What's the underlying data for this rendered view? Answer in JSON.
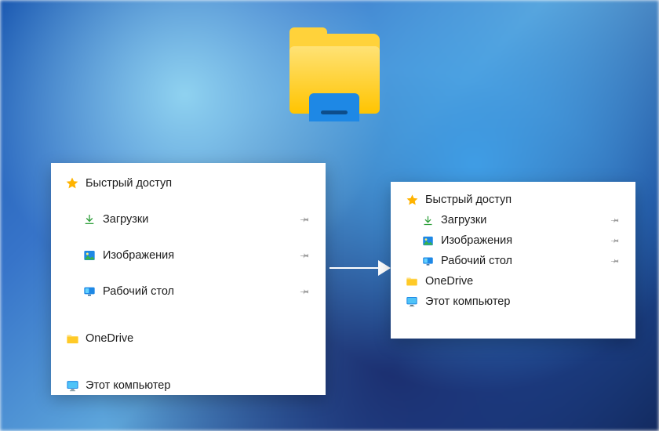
{
  "colors": {
    "accent_yellow": "#ffc400",
    "accent_blue": "#1e88e5",
    "pin_gray": "#a0a0a0"
  },
  "left": {
    "quick_access": "Быстрый доступ",
    "items": [
      {
        "label": "Загрузки",
        "icon": "download-icon",
        "pinned": true
      },
      {
        "label": "Изображения",
        "icon": "pictures-icon",
        "pinned": true
      },
      {
        "label": "Рабочий стол",
        "icon": "desktop-icon",
        "pinned": true
      }
    ],
    "onedrive": "OneDrive",
    "this_pc": "Этот компьютер"
  },
  "right": {
    "quick_access": "Быстрый доступ",
    "items": [
      {
        "label": "Загрузки",
        "icon": "download-icon",
        "pinned": true
      },
      {
        "label": "Изображения",
        "icon": "pictures-icon",
        "pinned": true
      },
      {
        "label": "Рабочий стол",
        "icon": "desktop-icon",
        "pinned": true
      }
    ],
    "onedrive": "OneDrive",
    "this_pc": "Этот компьютер"
  }
}
